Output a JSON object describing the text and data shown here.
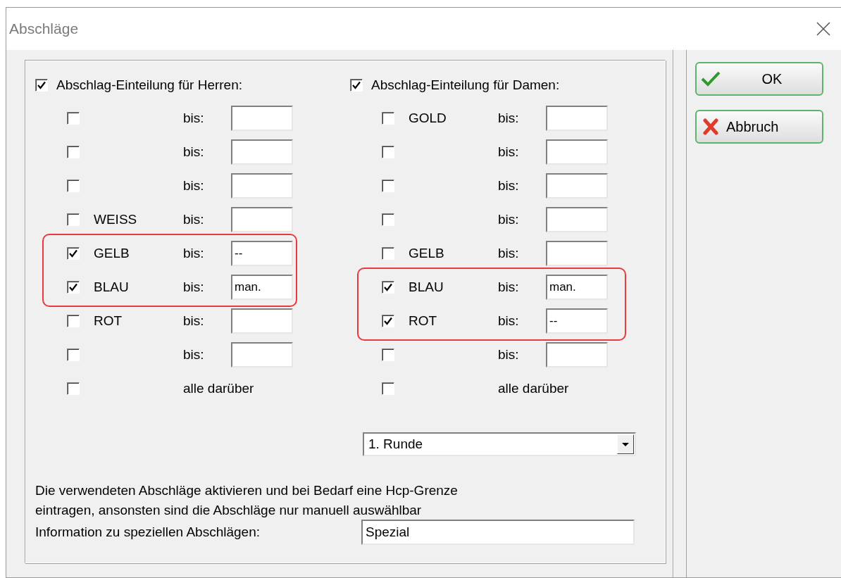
{
  "window": {
    "title": "Abschläge"
  },
  "groups": [
    {
      "label": "Abschlag-Einteilung für Herren:",
      "checked": true,
      "rows": [
        {
          "kind": "limit",
          "checked": false,
          "bis": "bis:",
          "highlighted": false
        },
        {
          "kind": "limit",
          "checked": false,
          "bis": "bis:",
          "highlighted": false
        },
        {
          "kind": "limit",
          "checked": false,
          "bis": "bis:",
          "highlighted": false
        },
        {
          "kind": "limit",
          "checked": false,
          "name": "WEISS",
          "bis": "bis:",
          "highlighted": false
        },
        {
          "kind": "limit",
          "checked": true,
          "name": "GELB",
          "bis": "bis:",
          "value": "--",
          "highlighted": true
        },
        {
          "kind": "limit",
          "checked": true,
          "name": "BLAU",
          "bis": "bis:",
          "value": "man.",
          "highlighted": true
        },
        {
          "kind": "limit",
          "checked": false,
          "name": "ROT",
          "bis": "bis:",
          "highlighted": false
        },
        {
          "kind": "limit",
          "checked": false,
          "bis": "bis:",
          "highlighted": false
        },
        {
          "kind": "rest",
          "checked": false,
          "bis": "alle darüber",
          "highlighted": false
        }
      ]
    },
    {
      "label": "Abschlag-Einteilung für Damen:",
      "checked": true,
      "rows": [
        {
          "kind": "limit",
          "checked": false,
          "name": "GOLD",
          "bis": "bis:",
          "highlighted": false
        },
        {
          "kind": "limit",
          "checked": false,
          "bis": "bis:",
          "highlighted": false
        },
        {
          "kind": "limit",
          "checked": false,
          "bis": "bis:",
          "highlighted": false
        },
        {
          "kind": "limit",
          "checked": false,
          "bis": "bis:",
          "highlighted": false
        },
        {
          "kind": "limit",
          "checked": false,
          "name": "GELB",
          "bis": "bis:",
          "highlighted": false
        },
        {
          "kind": "limit",
          "checked": true,
          "name": "BLAU",
          "bis": "bis:",
          "value": "man.",
          "highlighted": true
        },
        {
          "kind": "limit",
          "checked": true,
          "name": "ROT",
          "bis": "bis:",
          "value": "--",
          "highlighted": true
        },
        {
          "kind": "limit",
          "checked": false,
          "bis": "bis:",
          "highlighted": false
        },
        {
          "kind": "rest",
          "checked": false,
          "bis": "alle darüber",
          "highlighted": false
        }
      ]
    }
  ],
  "round_dropdown": {
    "value": "1. Runde"
  },
  "note_lines": [
    "Die verwendeten Abschläge aktivieren und bei Bedarf eine Hcp-Grenze",
    "eintragen, ansonsten sind die Abschläge nur manuell auswählbar"
  ],
  "info": {
    "label": "Information zu speziellen Abschlägen:",
    "value": "Spezial"
  },
  "buttons": [
    {
      "kind": "ok",
      "label": "OK"
    },
    {
      "kind": "cancel",
      "label": "Abbruch"
    }
  ]
}
